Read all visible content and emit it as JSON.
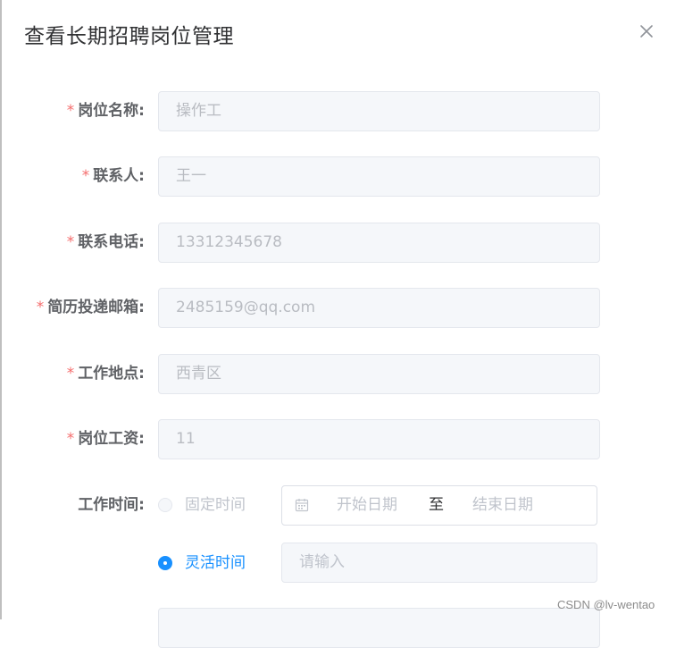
{
  "dialog": {
    "title": "查看长期招聘岗位管理"
  },
  "form": {
    "fields": [
      {
        "label": "岗位名称:",
        "value": "操作工",
        "required": true
      },
      {
        "label": "联系人:",
        "value": "王一",
        "required": true
      },
      {
        "label": "联系电话:",
        "value": "13312345678",
        "required": true
      },
      {
        "label": "简历投递邮箱:",
        "value": "2485159@qq.com",
        "required": true
      },
      {
        "label": "工作地点:",
        "value": "西青区",
        "required": true
      },
      {
        "label": "岗位工资:",
        "value": "11",
        "required": true
      }
    ],
    "required_mark": "*",
    "work_time": {
      "label": "工作时间:",
      "fixed_option": "固定时间",
      "flexible_option": "灵活时间",
      "selected": "灵活时间",
      "start_placeholder": "开始日期",
      "range_separator": "至",
      "end_placeholder": "结束日期",
      "flexible_placeholder": "请输入"
    }
  },
  "watermark": "CSDN @lv-wentao",
  "colors": {
    "accent": "#1890ff",
    "required": "#f56c6c"
  }
}
